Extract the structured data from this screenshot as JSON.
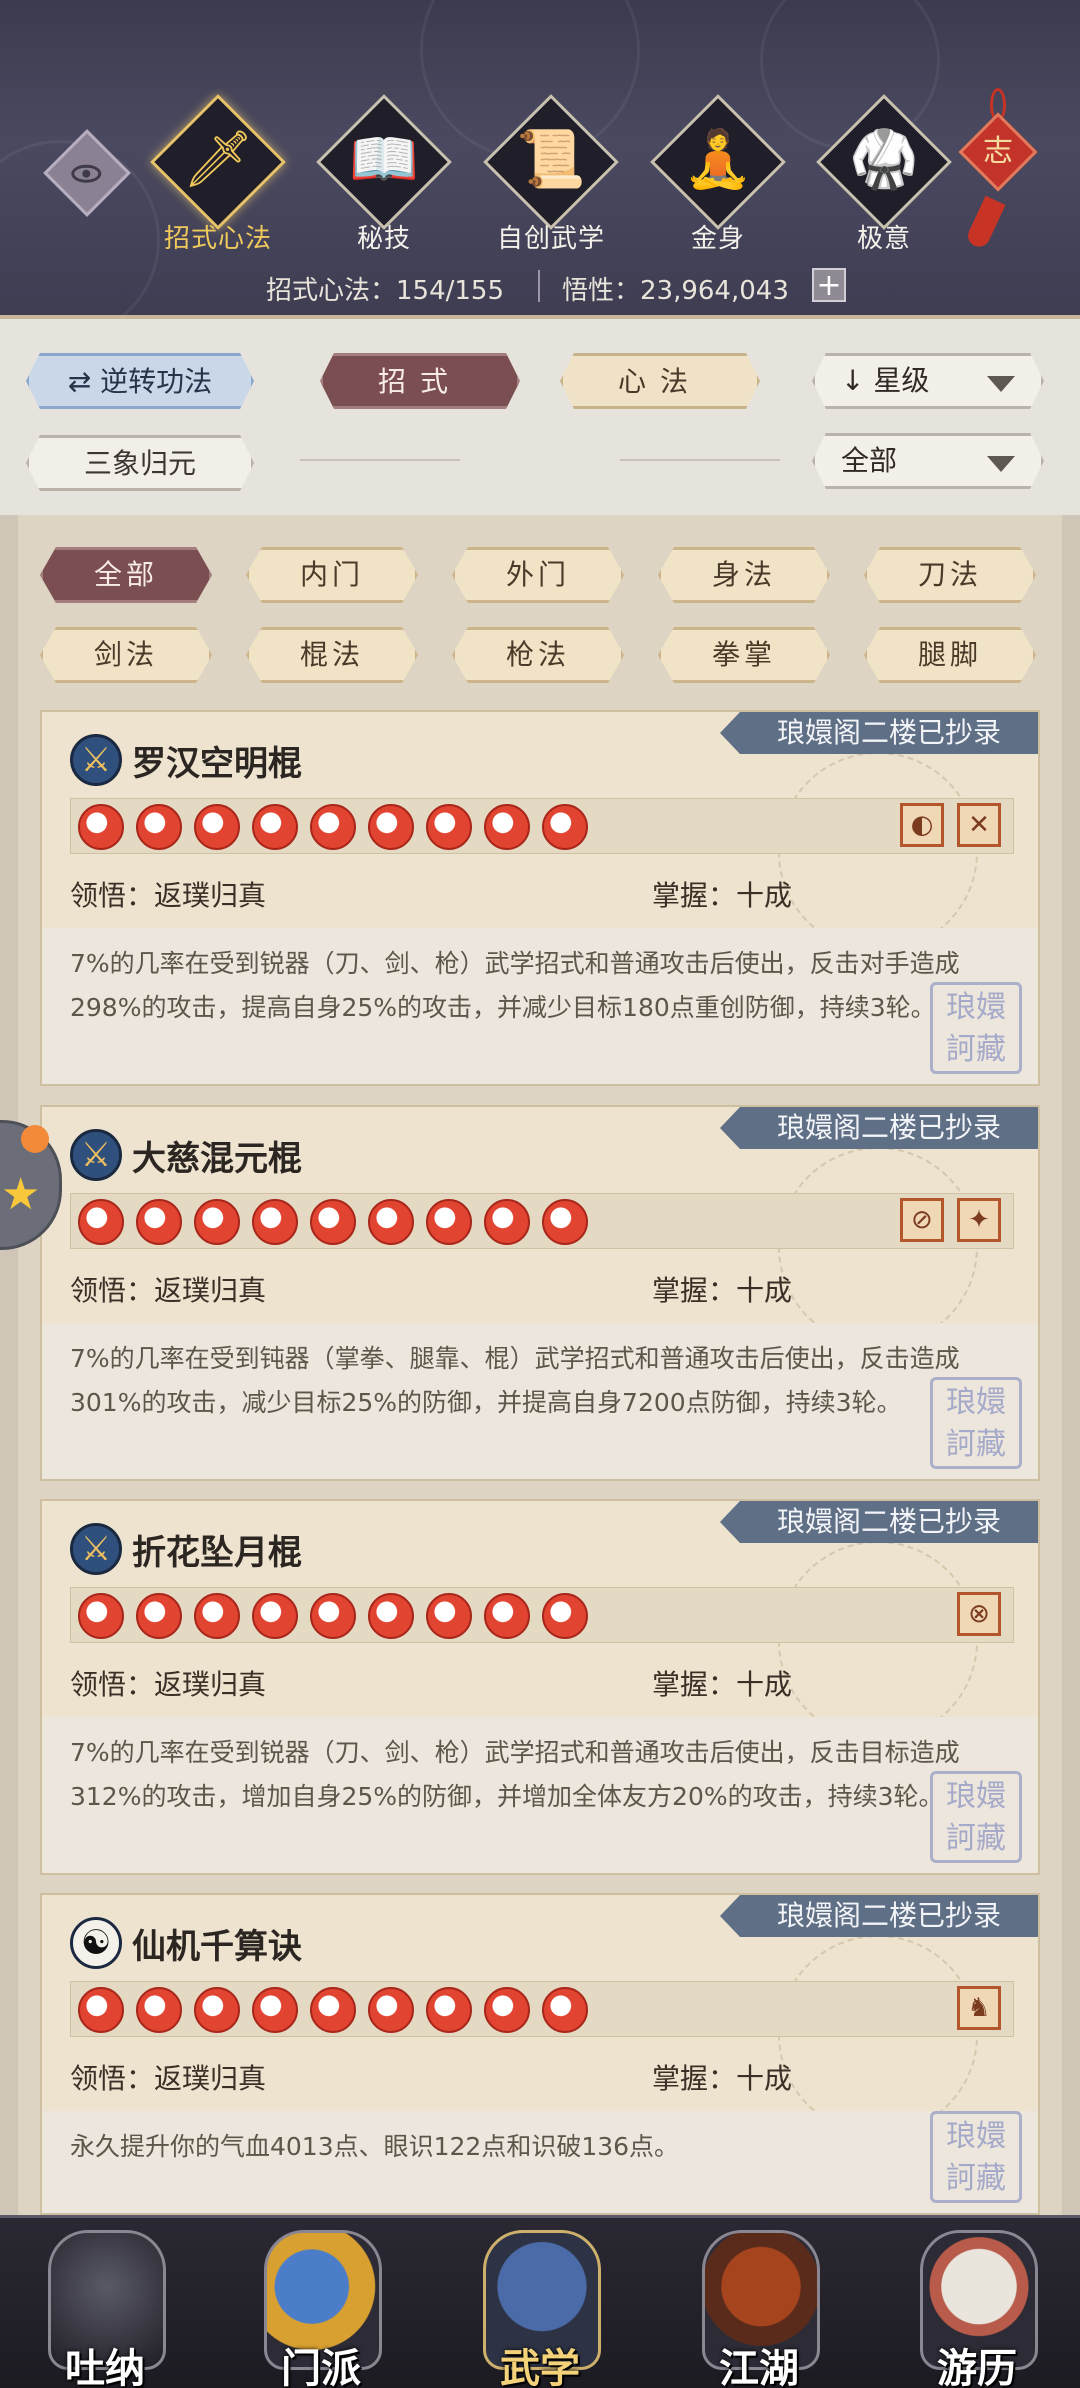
{
  "header": {
    "tabs": [
      {
        "label": "招式心法",
        "icon": "sword-icon",
        "glyph": "🗡",
        "active": true
      },
      {
        "label": "秘技",
        "icon": "book-icon",
        "glyph": "📖",
        "active": false
      },
      {
        "label": "自创武学",
        "icon": "scroll-icon",
        "glyph": "📜",
        "active": false
      },
      {
        "label": "金身",
        "icon": "meditating-figure-icon",
        "glyph": "🧘",
        "active": false
      },
      {
        "label": "极意",
        "icon": "martial-pose-icon",
        "glyph": "🥋",
        "active": false
      }
    ],
    "charm_text": "志",
    "stat_moves": "招式心法：154/155",
    "stat_insight": "悟性：23,964,043",
    "plus_label": "+"
  },
  "filters": {
    "reverse_label": "逆转功法",
    "reverse_icon": "⇄",
    "moves_label": "招式",
    "heart_label": "心法",
    "sort_label": "星级",
    "sort_icon": "↓",
    "sanxiang_label": "三象归元",
    "scope_label": "全部"
  },
  "categories": [
    "全部",
    "内门",
    "外门",
    "身法",
    "刀法",
    "剑法",
    "棍法",
    "枪法",
    "拳掌",
    "腿脚"
  ],
  "skills": [
    {
      "name": "罗汉空明棍",
      "ribbon": "琅嬛阁二楼已抄录",
      "icon_glyph": "⚔",
      "type_icons": [
        "◐",
        "✕"
      ],
      "comprehension": "领悟：返璞归真",
      "mastery": "掌握：十成",
      "description": "7%的几率在受到锐器（刀、剑、枪）武学招式和普通攻击后使出，反击对手造成298%的攻击，提高自身25%的攻击，并减少目标180点重创防御，持续3轮。"
    },
    {
      "name": "大慈混元棍",
      "ribbon": "琅嬛阁二楼已抄录",
      "icon_glyph": "⚔",
      "type_icons": [
        "⊘",
        "✦"
      ],
      "comprehension": "领悟：返璞归真",
      "mastery": "掌握：十成",
      "description": "7%的几率在受到钝器（掌拳、腿靠、棍）武学招式和普通攻击后使出，反击造成301%的攻击，减少目标25%的防御，并提高自身7200点防御，持续3轮。"
    },
    {
      "name": "折花坠月棍",
      "ribbon": "琅嬛阁二楼已抄录",
      "icon_glyph": "⚔",
      "type_icons": [
        "⊗"
      ],
      "comprehension": "领悟：返璞归真",
      "mastery": "掌握：十成",
      "description": "7%的几率在受到锐器（刀、剑、枪）武学招式和普通攻击后使出，反击目标造成312%的攻击，增加自身25%的防御，并增加全体友方20%的攻击，持续3轮。"
    },
    {
      "name": "仙机千算诀",
      "ribbon": "琅嬛阁二楼已抄录",
      "icon_glyph": "☯",
      "type_icons": [
        "♞"
      ],
      "comprehension": "领悟：返璞归真",
      "mastery": "掌握：十成",
      "description": "永久提升你的气血4013点、眼识122点和识破136点。"
    }
  ],
  "star_count": 9,
  "seal_text": "琅嬛\n訶藏",
  "bottom_nav": [
    {
      "label": "吐纳",
      "active": false
    },
    {
      "label": "门派",
      "active": false
    },
    {
      "label": "武学",
      "active": true
    },
    {
      "label": "江湖",
      "active": false
    },
    {
      "label": "游历",
      "active": false
    }
  ],
  "colors": {
    "header_bg": "#3f3e53",
    "active_gold": "#f0c95c",
    "ribbon": "#5f6f86",
    "star_red": "#e24432",
    "active_chip": "#7b4f52"
  }
}
